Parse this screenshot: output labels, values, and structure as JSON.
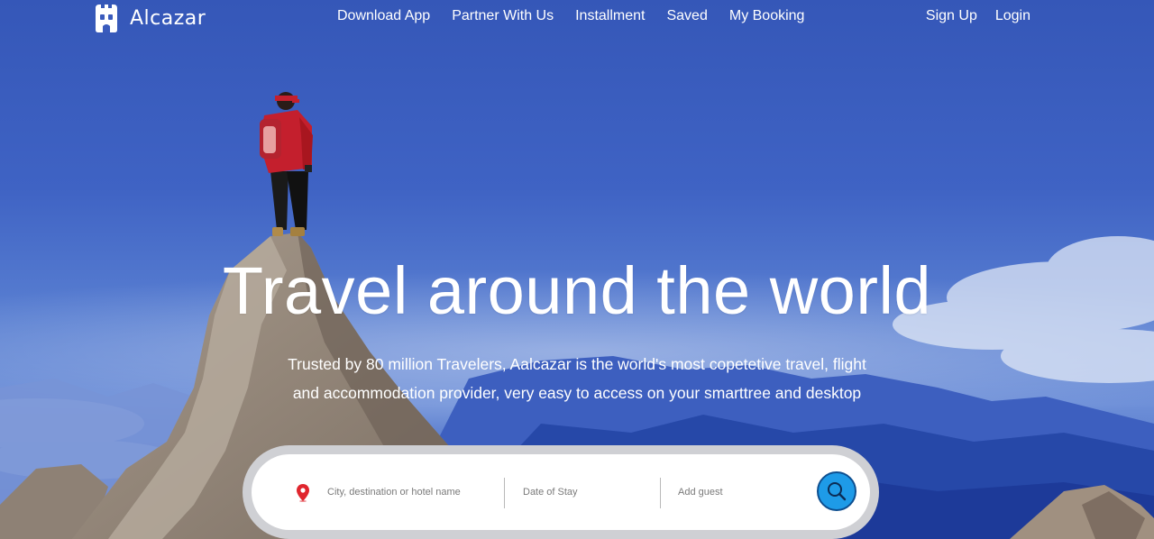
{
  "nav": {
    "brand": "Alcazar",
    "links": [
      "Download App",
      "Partner With Us",
      "Installment",
      "Saved",
      "My Booking"
    ],
    "sign_up": "Sign Up",
    "login": "Login"
  },
  "hero": {
    "title": "Travel around the world",
    "subtitle_line1": "Trusted by 80 million Travelers, Aalcazar is the world's most copetetive travel, flight",
    "subtitle_line2": "and accommodation provider, very easy to access on your smarttree and desktop"
  },
  "search": {
    "location_placeholder": "City, destination or hotel name",
    "date_placeholder": "Date of Stay",
    "guest_placeholder": "Add guest"
  },
  "colors": {
    "accent": "#1e9be8",
    "pin": "#e0262e",
    "sky": "#3f63c4"
  },
  "icons": [
    "alcazar-logo-icon",
    "map-pin-icon",
    "search-icon"
  ]
}
